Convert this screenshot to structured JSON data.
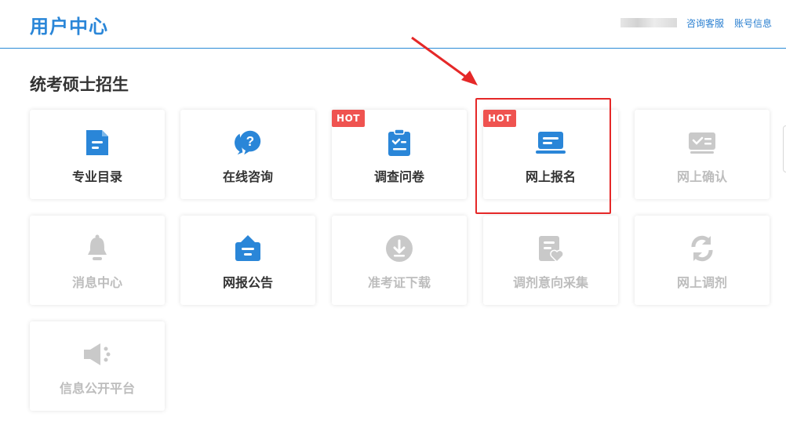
{
  "header": {
    "title": "用户中心",
    "consult_link": "咨询客服",
    "account_link": "账号信息"
  },
  "section": {
    "title": "统考硕士招生"
  },
  "colors": {
    "brand": "#2a86d8",
    "hot_badge": "#ef5350",
    "disabled": "#bdbdbd",
    "highlight": "#e52828"
  },
  "cards": [
    {
      "label": "专业目录",
      "icon": "document-icon",
      "enabled": true,
      "hot": false
    },
    {
      "label": "在线咨询",
      "icon": "chat-question-icon",
      "enabled": true,
      "hot": false
    },
    {
      "label": "调查问卷",
      "icon": "clipboard-check-icon",
      "enabled": true,
      "hot": true,
      "badge": "HOT"
    },
    {
      "label": "网上报名",
      "icon": "laptop-icon",
      "enabled": true,
      "hot": true,
      "badge": "HOT"
    },
    {
      "label": "网上确认",
      "icon": "id-card-check-icon",
      "enabled": false,
      "hot": false
    },
    {
      "label": "消息中心",
      "icon": "bell-icon",
      "enabled": false,
      "hot": false
    },
    {
      "label": "网报公告",
      "icon": "notice-bag-icon",
      "enabled": true,
      "hot": false
    },
    {
      "label": "准考证下载",
      "icon": "download-icon",
      "enabled": false,
      "hot": false
    },
    {
      "label": "调剂意向采集",
      "icon": "form-heart-icon",
      "enabled": false,
      "hot": false
    },
    {
      "label": "网上调剂",
      "icon": "refresh-icon",
      "enabled": false,
      "hot": false
    },
    {
      "label": "信息公开平台",
      "icon": "speaker-icon",
      "enabled": false,
      "hot": false
    }
  ]
}
